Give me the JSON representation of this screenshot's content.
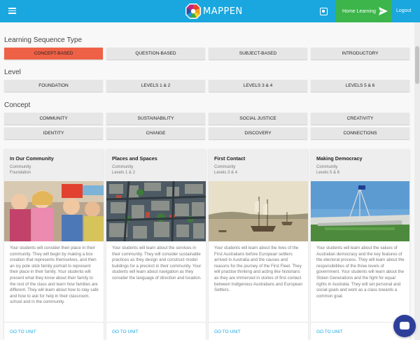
{
  "app": {
    "name": "MAPPEN",
    "brand_color": "#1aa7df",
    "home_button": "Home Learning",
    "logout": "Logout",
    "icons": {
      "menu": "menu-icon",
      "settings": "settings-icon",
      "send": "send-icon",
      "chat": "chat-icon"
    }
  },
  "filters": {
    "sequence_type": {
      "heading": "Learning Sequence Type",
      "options": [
        "CONCEPT-BASED",
        "QUESTION-BASED",
        "SUBJECT-BASED",
        "INTRODUCTORY"
      ],
      "selected": "CONCEPT-BASED"
    },
    "level": {
      "heading": "Level",
      "options": [
        "FOUNDATION",
        "LEVELS 1 & 2",
        "LEVELS 3 & 4",
        "LEVELS 5 & 6"
      ]
    },
    "concept": {
      "heading": "Concept",
      "options": [
        "COMMUNITY",
        "SUSTAINABILITY",
        "SOCIAL JUSTICE",
        "CREATIVITY",
        "IDENTITY",
        "CHANGE",
        "DISCOVERY",
        "CONNECTIONS"
      ]
    }
  },
  "cards": [
    {
      "title": "In Our Community",
      "concept": "Community",
      "level": "Foundation",
      "description": "Your students will consider their place in their community. They will begin by making a box creation that represents themselves, and then an icy pole stick family portrait to represent their place in their family. Your students will present what they know about their family to the rest of the class and learn how families are different. They will learn about how to stay safe and how to ask for help in their classroom, school and in the community.",
      "link": "GO TO UNIT"
    },
    {
      "title": "Places and Spaces",
      "concept": "Community",
      "level": "Levels 1 & 2",
      "description": "Your students will learn about the services in their community. They will consider sustainable practices as they design and construct model buildings for a precinct in their community. Your students will learn about navigation as they consider the language of direction and location.",
      "link": "GO TO UNIT"
    },
    {
      "title": "First Contact",
      "concept": "Community",
      "level": "Levels 3 & 4",
      "description": "Your students will learn about the lives of the First Australians before European settlers arrived in Australia and the causes and reasons for the journey of the First Fleet. They will practise thinking and acting like historians as they are immersed in stories of first contact between Indigenous Australians and European Settlers.",
      "link": "GO TO UNIT"
    },
    {
      "title": "Making Democracy",
      "concept": "Community",
      "level": "Levels 5 & 6",
      "description": "Your students will learn about the values of Australian democracy and the key features of the electoral process. They will learn about the responsibilities of the three levels of government. Your students will learn about the Stolen Generations and the fight for equal rights in Australia. They will set personal and social goals and work as a class towards a common goal.",
      "link": "GO TO UNIT"
    }
  ]
}
